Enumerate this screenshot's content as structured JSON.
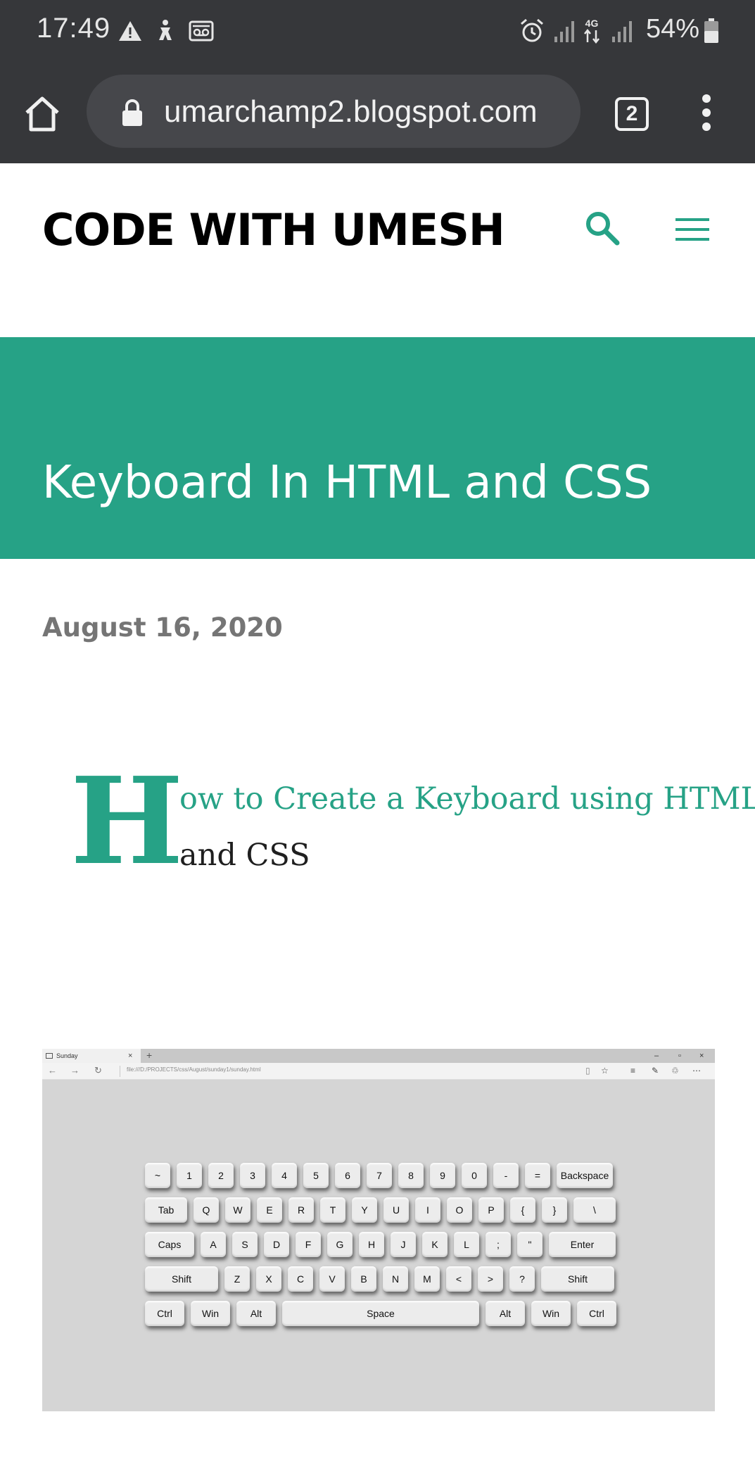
{
  "status_bar": {
    "time": "17:49",
    "battery": "54%",
    "network": "4G",
    "icons": [
      "warning-icon",
      "accessibility-icon",
      "voicemail-icon",
      "alarm-icon",
      "signal-icon",
      "data-arrows-icon",
      "battery-icon"
    ]
  },
  "browser": {
    "url": "umarchamp2.blogspot.com",
    "tab_count": "2",
    "icons": [
      "home-icon",
      "lock-icon",
      "overflow-menu-icon"
    ]
  },
  "site": {
    "title": "CODE WITH UMESH",
    "icons": [
      "search-icon",
      "hamburger-menu-icon"
    ]
  },
  "post": {
    "title": "Keyboard In HTML and CSS",
    "date": "August 16, 2020",
    "drop_cap": "H",
    "intro_line1": "ow to Create a Keyboard using HTML",
    "intro_line2": "and CSS"
  },
  "screenshot": {
    "tab_title": "Sunday",
    "tab_close": "×",
    "new_tab": "+",
    "address": "file:///D:/PROJECTS/css/August/sunday1/sunday.html",
    "window_controls": [
      "–",
      "▫",
      "×"
    ],
    "keyboard_rows": [
      [
        "~",
        "1",
        "2",
        "3",
        "4",
        "5",
        "6",
        "7",
        "8",
        "9",
        "0",
        "-",
        "=",
        "Backspace"
      ],
      [
        "Tab",
        "Q",
        "W",
        "E",
        "R",
        "T",
        "Y",
        "U",
        "I",
        "O",
        "P",
        "{",
        "}",
        "\\"
      ],
      [
        "Caps",
        "A",
        "S",
        "D",
        "F",
        "G",
        "H",
        "J",
        "K",
        "L",
        ";",
        "\"",
        "Enter"
      ],
      [
        "Shift",
        "Z",
        "X",
        "C",
        "V",
        "B",
        "N",
        "M",
        "<",
        ">",
        "?",
        "Shift"
      ],
      [
        "Ctrl",
        "Win",
        "Alt",
        "Space",
        "Alt",
        "Win",
        "Ctrl"
      ]
    ]
  },
  "colors": {
    "accent": "#26a286",
    "status_bar": "#36373a",
    "embedded_background": "#d5d5d5"
  }
}
